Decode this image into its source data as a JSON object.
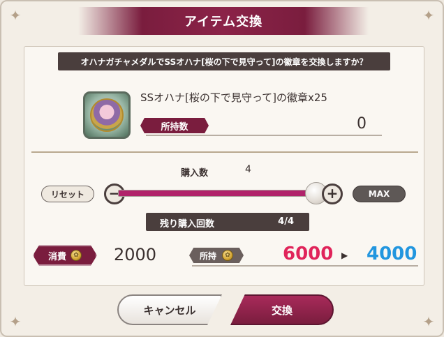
{
  "dialog": {
    "title": "アイテム交換",
    "question": "オハナガチャメダルでSSオハナ[桜の下で見守って]の徽章を交換しますか？"
  },
  "item": {
    "icon": "ohana-badge-icon",
    "name": "SSオハナ[桜の下で見守って]の徽章x25",
    "owned_label": "所持数",
    "owned_value": "0"
  },
  "quantity": {
    "label": "購入数",
    "value": "4",
    "reset_label": "リセット",
    "max_label": "MAX",
    "slider_fraction": 1.0
  },
  "remaining": {
    "label": "残り購入回数",
    "value": "4/4"
  },
  "cost": {
    "label": "消費",
    "currency_icon": "medal-icon",
    "value": "2000"
  },
  "holdings": {
    "label": "所持",
    "currency_icon": "medal-icon",
    "before": "6000",
    "after": "4000",
    "before_color": "#e0245a",
    "after_color": "#2296df"
  },
  "buttons": {
    "cancel_label": "キャンセル",
    "exchange_label": "交換"
  },
  "colors": {
    "accent": "#7a1d3e",
    "slider_fill": "#b0226a"
  }
}
